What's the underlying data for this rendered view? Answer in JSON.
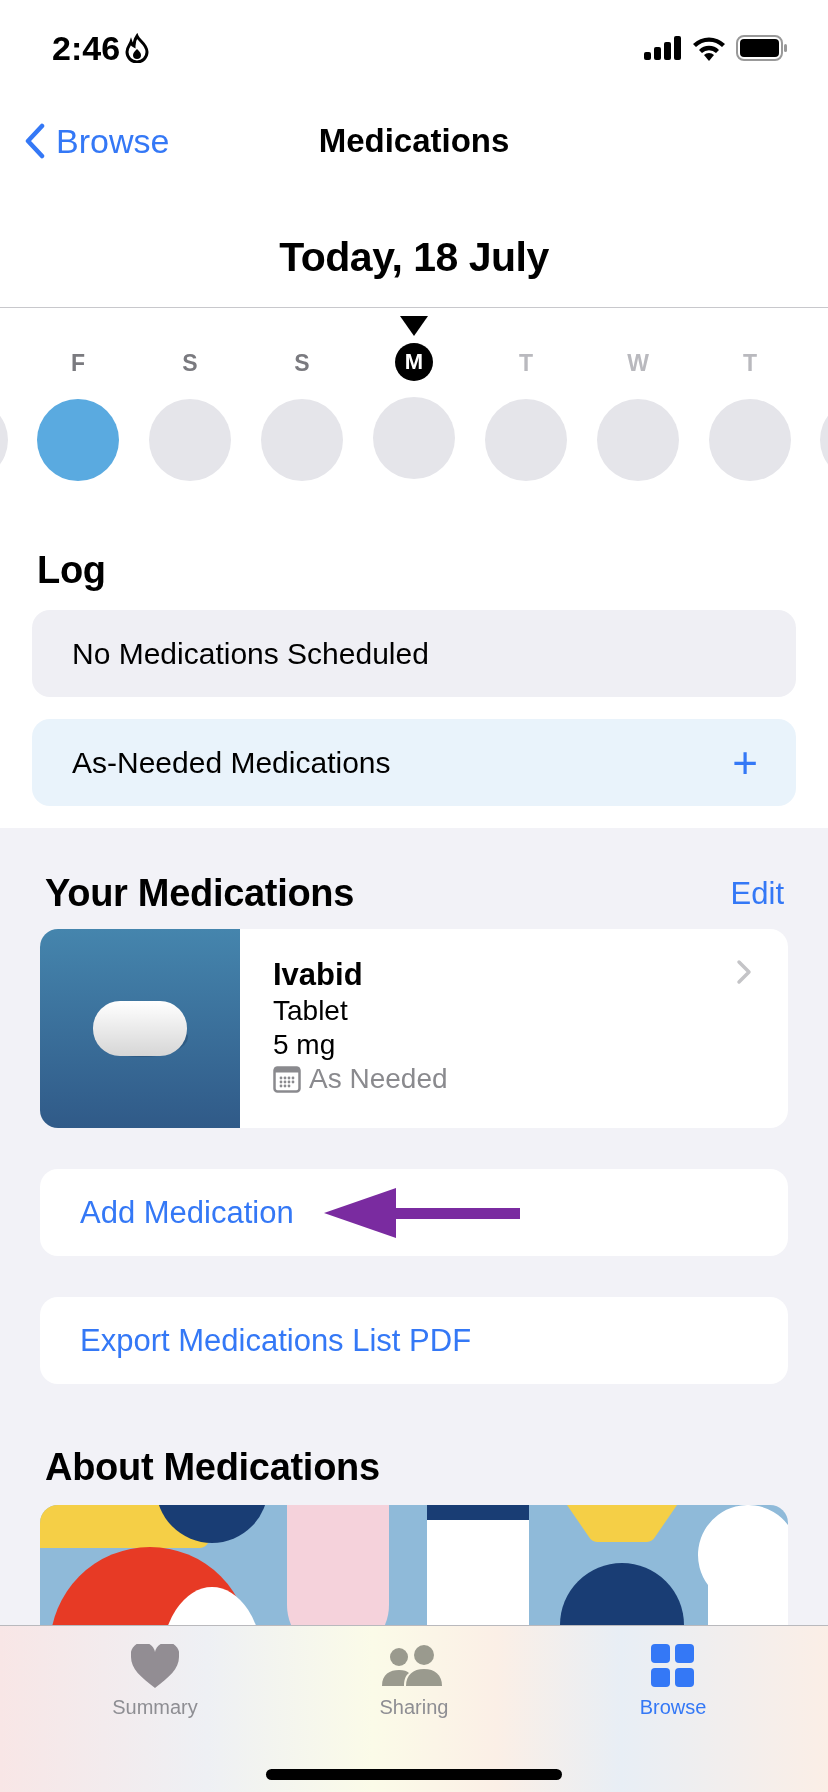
{
  "status_bar": {
    "time": "2:46"
  },
  "nav": {
    "back": "Browse",
    "title": "Medications"
  },
  "date_heading": "Today, 18 July",
  "days": [
    {
      "letter": "F",
      "selected": false,
      "past": true,
      "logged": true
    },
    {
      "letter": "S",
      "selected": false,
      "past": true,
      "logged": false
    },
    {
      "letter": "S",
      "selected": false,
      "past": true,
      "logged": false
    },
    {
      "letter": "M",
      "selected": true,
      "past": false,
      "logged": false
    },
    {
      "letter": "T",
      "selected": false,
      "past": false,
      "logged": false
    },
    {
      "letter": "W",
      "selected": false,
      "past": false,
      "logged": false
    },
    {
      "letter": "T",
      "selected": false,
      "past": false,
      "logged": false
    }
  ],
  "log": {
    "heading": "Log",
    "rows": [
      {
        "kind": "info",
        "label": "No Medications Scheduled"
      },
      {
        "kind": "add",
        "label": "As-Needed Medications",
        "action": "+"
      }
    ]
  },
  "your_medications": {
    "heading": "Your Medications",
    "edit": "Edit",
    "items": [
      {
        "name": "Ivabid",
        "form": "Tablet",
        "dose": "5 mg",
        "schedule": "As Needed"
      }
    ],
    "actions": [
      {
        "label": "Add Medication",
        "highlighted": true
      },
      {
        "label": "Export Medications List PDF",
        "highlighted": false
      }
    ]
  },
  "about": {
    "heading": "About Medications"
  },
  "tab_bar": [
    {
      "label": "Summary",
      "kind": "heart",
      "selected": false
    },
    {
      "label": "Sharing",
      "kind": "people",
      "selected": false
    },
    {
      "label": "Browse",
      "kind": "grid",
      "selected": true
    }
  ]
}
